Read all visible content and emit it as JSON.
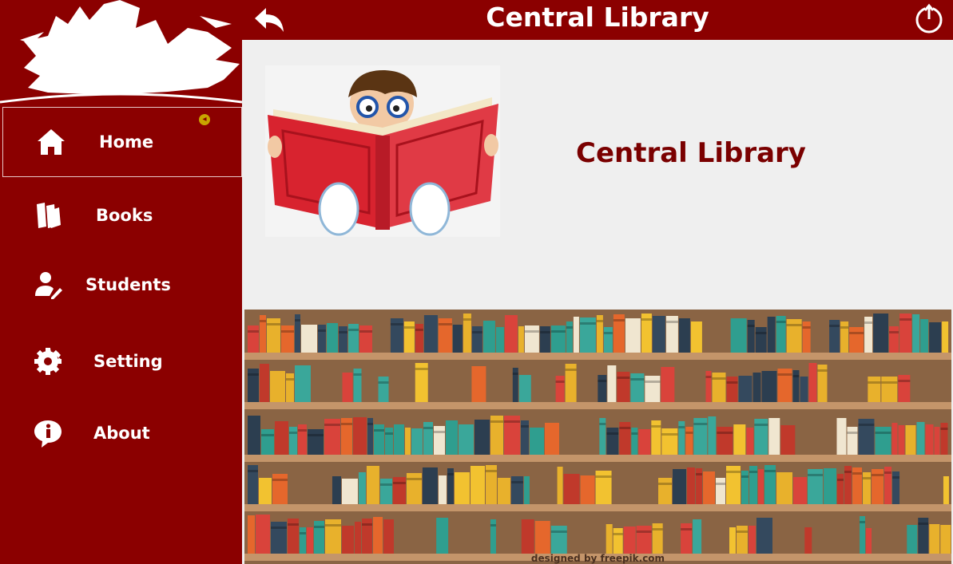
{
  "header": {
    "title": "Central Library"
  },
  "sidebar": {
    "items": [
      {
        "label": "Home",
        "icon": "home-icon",
        "active": true
      },
      {
        "label": "Books",
        "icon": "books-icon",
        "active": false
      },
      {
        "label": "Students",
        "icon": "student-icon",
        "active": false
      },
      {
        "label": "Setting",
        "icon": "gear-icon",
        "active": false
      },
      {
        "label": "About",
        "icon": "info-icon",
        "active": false
      }
    ]
  },
  "main": {
    "title": "Central Library",
    "credit": "designed by freepik.com"
  },
  "colors": {
    "brand": "#8b0000",
    "title": "#7a0000",
    "background": "#efefef"
  }
}
